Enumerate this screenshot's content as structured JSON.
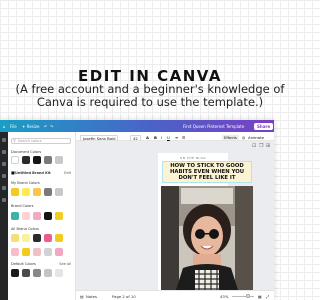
{
  "headline": "EDIT IN CANVA",
  "subline": "(A free account and a beginner's knowledge of Canva is required to use the template.)",
  "topbar": {
    "file": "File",
    "resize": "✦ Resize",
    "doc_name": "First Queen Pinterest Template",
    "share": "Share"
  },
  "panel": {
    "search_placeholder": "Search colors",
    "document_colors": "Document Colors",
    "brand_kit": "Untitled Brand Kit",
    "edit": "Edit",
    "row1_label": "My Brand Colors",
    "row2_label": "Brand Colors",
    "row3_label": "All Brand Colors",
    "default_colors": "Default Colors",
    "see_all": "See all",
    "swatches_row0": [
      "#ffffff",
      "#2b2b2b",
      "#151515",
      "#7a7a7a",
      "#c9c9c9"
    ],
    "swatches_row1": [
      "#f3ca1f",
      "#f8ec52",
      "#f9c64a",
      "#7a7a7a",
      "#c9c9c9"
    ],
    "swatches_row2": [
      "#3fb3a7",
      "#ffd0d6",
      "#f3a8c1",
      "#141414",
      "#f3ca1f"
    ],
    "swatches_row3": [
      "#f4df7a",
      "#f7f49c",
      "#2b2b2b",
      "#ec5d8c",
      "#f3ca1f"
    ],
    "swatches_row4": [
      "#f9bcc9",
      "#f3ca1f",
      "#f0c0c4",
      "#d2d2d2",
      "#f3a8c1"
    ],
    "swatches_row5": [
      "#1b1b1b",
      "#4a4a4a",
      "#888888",
      "#c4c4c4",
      "#e5e5e5"
    ]
  },
  "toolbar": {
    "font": "Josefin Sans Bold",
    "size": "42",
    "effects": "Effects",
    "animate": "Animate"
  },
  "design": {
    "kicker": "ON THE BLOG",
    "title": "HOW TO STICK TO GOOD HABITS EVEN WHEN YOU DON'T FEEL LIKE IT"
  },
  "status": {
    "notes": "Notes",
    "page": "Page 2 of 10",
    "zoom": "43%"
  },
  "colors": {
    "gradient_start": "#1a9ec4",
    "gradient_end": "#7a3fc4",
    "rail": "#252627",
    "title_bg": "#fbf3d2"
  }
}
